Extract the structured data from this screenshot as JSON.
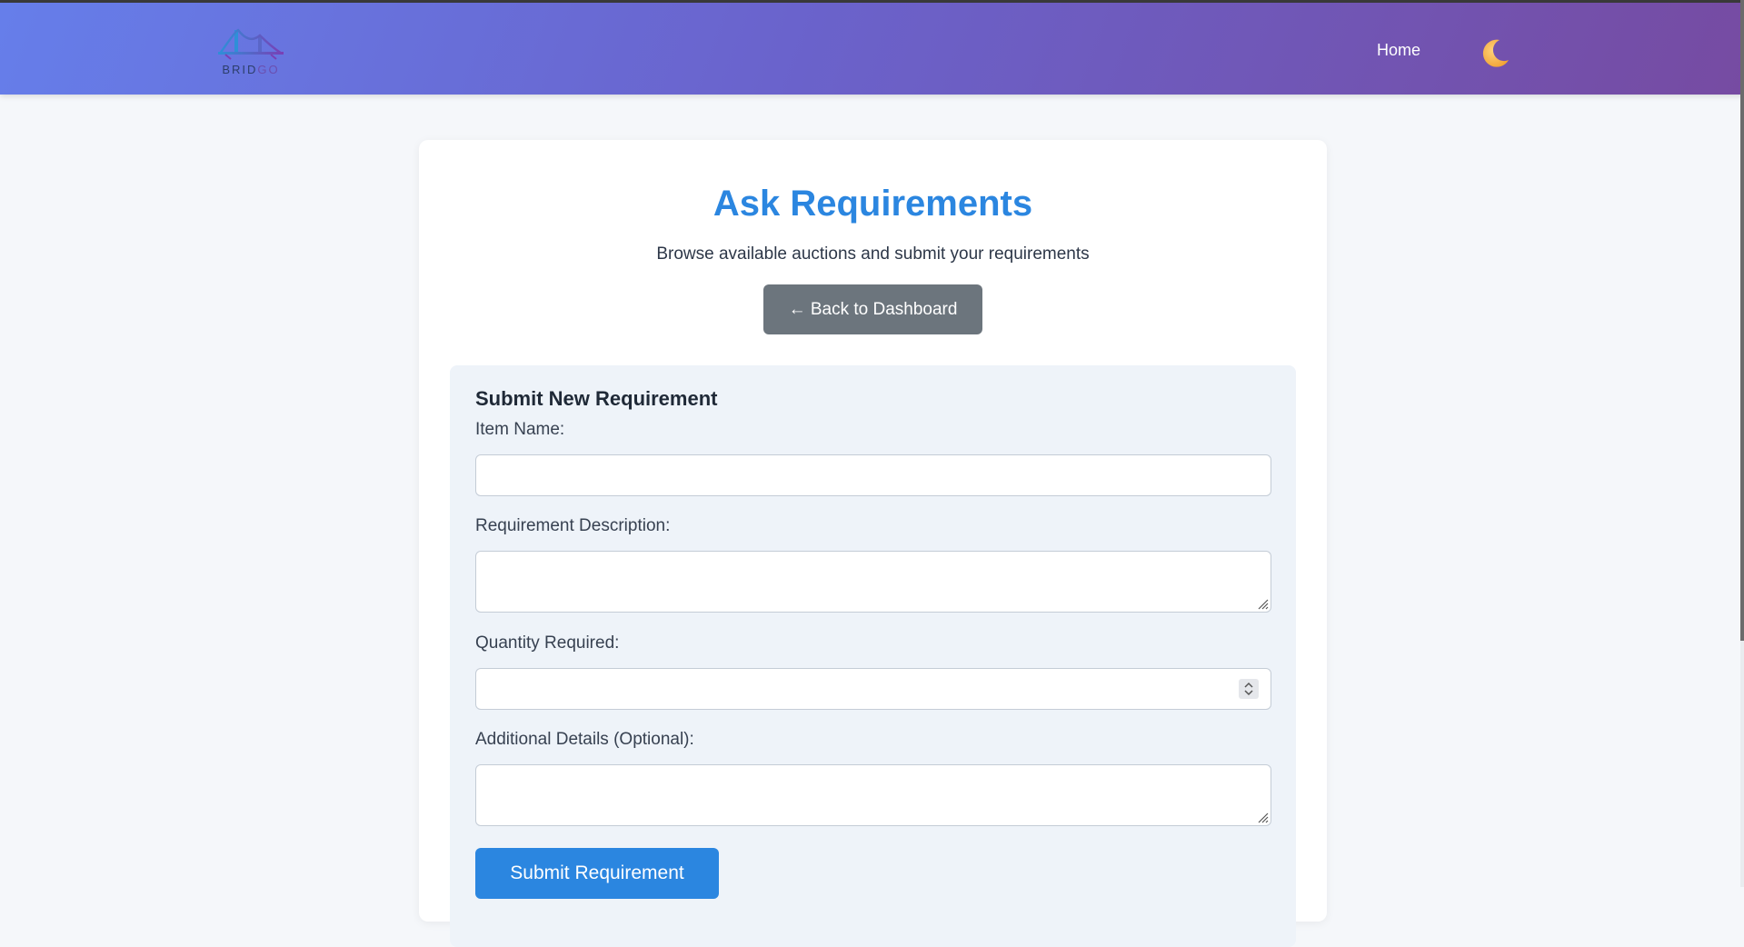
{
  "nav": {
    "logo_text_a": "BRID",
    "logo_text_b": "GO",
    "home_label": "Home",
    "theme_icon": "moon-icon"
  },
  "page": {
    "title": "Ask Requirements",
    "subtitle": "Browse available auctions and submit your requirements",
    "back_label": "← Back to Dashboard"
  },
  "form": {
    "heading": "Submit New Requirement",
    "item_name_label": "Item Name:",
    "item_name_value": "",
    "description_label": "Requirement Description:",
    "description_value": "",
    "quantity_label": "Quantity Required:",
    "quantity_value": "",
    "details_label": "Additional Details (Optional):",
    "details_value": "",
    "submit_label": "Submit Requirement"
  },
  "colors": {
    "brand_gradient_start": "#667eea",
    "brand_gradient_end": "#764ba2",
    "primary": "#2b86e0",
    "secondary": "#6c757d"
  }
}
